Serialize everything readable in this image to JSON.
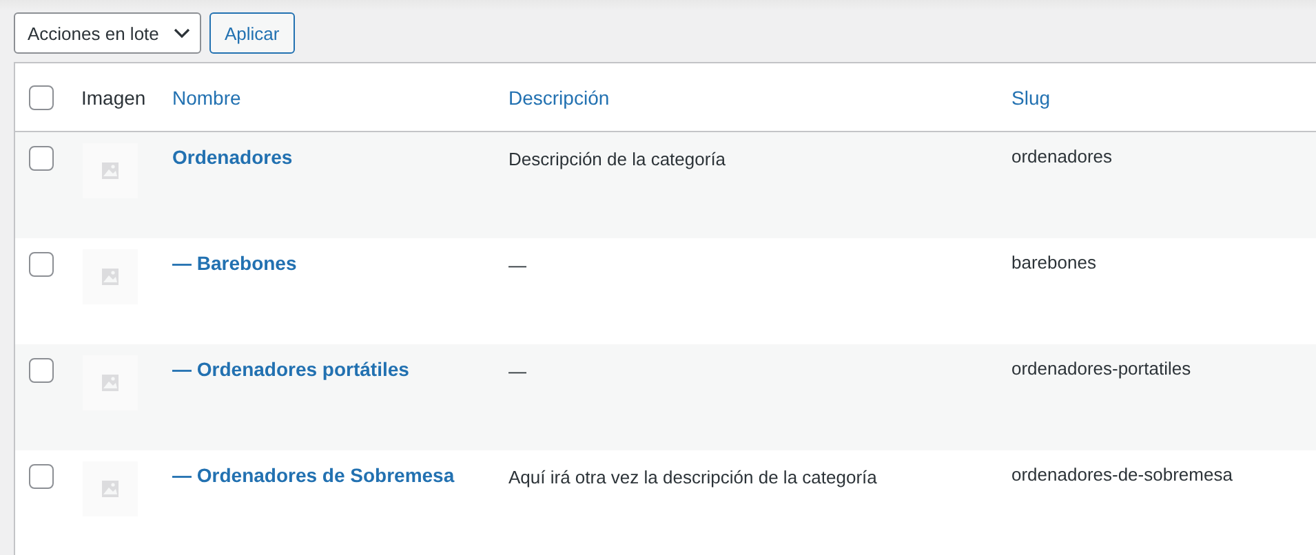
{
  "bulk_actions": {
    "select": {
      "value": "Acciones en lote"
    },
    "apply_button": "Aplicar"
  },
  "table": {
    "select_all": {
      "checked": false
    },
    "columns": [
      {
        "label": "Imagen",
        "sortable": false
      },
      {
        "label": "Nombre",
        "sortable": true
      },
      {
        "label": "Descripción",
        "sortable": true
      },
      {
        "label": "Slug",
        "sortable": true
      }
    ],
    "rows": [
      {
        "checked": false,
        "name": "Ordenadores",
        "description": "Descripción de la categoría",
        "slug": "ordenadores"
      },
      {
        "checked": false,
        "name": "— Barebones",
        "description": "—",
        "slug": "barebones"
      },
      {
        "checked": false,
        "name": "— Ordenadores portátiles",
        "description": "—",
        "slug": "ordenadores-portatiles"
      },
      {
        "checked": false,
        "name": "— Ordenadores de Sobremesa",
        "description": "Aquí irá otra vez la descripción de la categoría",
        "slug": "ordenadores-de-sobremesa"
      }
    ]
  }
}
